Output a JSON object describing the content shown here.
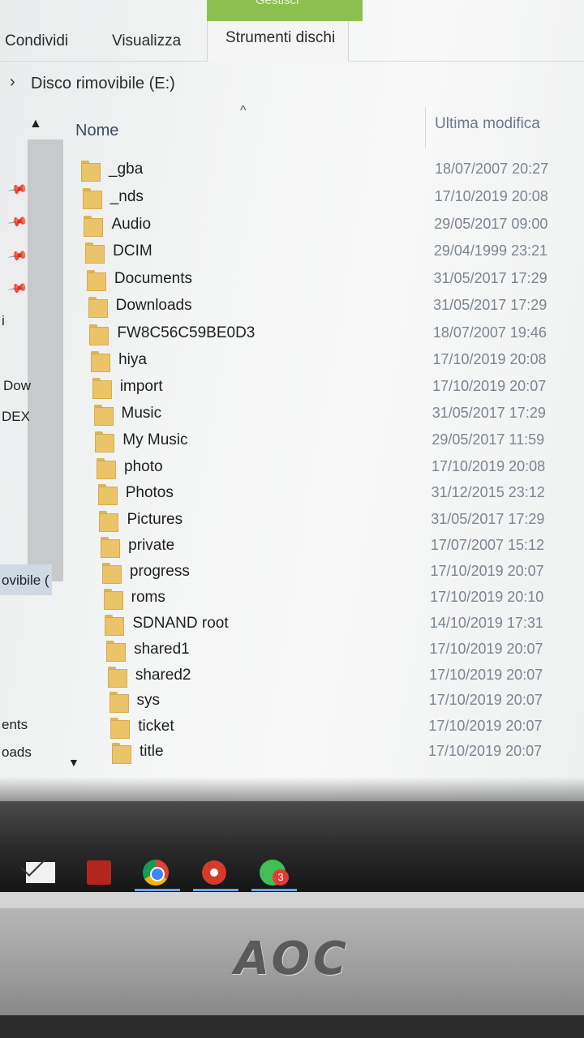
{
  "ribbon": {
    "context_group": "Gestisci",
    "tabs": [
      "Condividi",
      "Visualizza",
      "Strumenti dischi"
    ]
  },
  "address": {
    "path": "Disco rimovibile (E:)"
  },
  "nav": {
    "items": [
      "Dow",
      "DEX",
      "ovibile (",
      "ents",
      "oads",
      "i"
    ]
  },
  "columns": {
    "name": "Nome",
    "modified": "Ultima modifica"
  },
  "files": [
    {
      "name": "_gba",
      "date": "18/07/2007 20:27"
    },
    {
      "name": "_nds",
      "date": "17/10/2019 20:08"
    },
    {
      "name": "Audio",
      "date": "29/05/2017 09:00"
    },
    {
      "name": "DCIM",
      "date": "29/04/1999 23:21"
    },
    {
      "name": "Documents",
      "date": "31/05/2017 17:29"
    },
    {
      "name": "Downloads",
      "date": "31/05/2017 17:29"
    },
    {
      "name": "FW8C56C59BE0D3",
      "date": "18/07/2007 19:46"
    },
    {
      "name": "hiya",
      "date": "17/10/2019 20:08"
    },
    {
      "name": "import",
      "date": "17/10/2019 20:07"
    },
    {
      "name": "Music",
      "date": "31/05/2017 17:29"
    },
    {
      "name": "My Music",
      "date": "29/05/2017 11:59"
    },
    {
      "name": "photo",
      "date": "17/10/2019 20:08"
    },
    {
      "name": "Photos",
      "date": "31/12/2015 23:12"
    },
    {
      "name": "Pictures",
      "date": "31/05/2017 17:29"
    },
    {
      "name": "private",
      "date": "17/07/2007 15:12"
    },
    {
      "name": "progress",
      "date": "17/10/2019 20:07"
    },
    {
      "name": "roms",
      "date": "17/10/2019 20:10"
    },
    {
      "name": "SDNAND root",
      "date": "14/10/2019 17:31"
    },
    {
      "name": "shared1",
      "date": "17/10/2019 20:07"
    },
    {
      "name": "shared2",
      "date": "17/10/2019 20:07"
    },
    {
      "name": "sys",
      "date": "17/10/2019 20:07"
    },
    {
      "name": "ticket",
      "date": "17/10/2019 20:07"
    },
    {
      "name": "title",
      "date": "17/10/2019 20:07"
    }
  ],
  "taskbar": {
    "apps": [
      "mail-icon",
      "red-app-icon",
      "chrome-icon",
      "record-icon",
      "whatsapp-icon"
    ],
    "whatsapp_badge": "3"
  },
  "monitor": {
    "brand": "AOC"
  },
  "colors": {
    "context_tab": "#8cc152",
    "folder": "#ebc46a",
    "accent": "#6aa6e8"
  }
}
